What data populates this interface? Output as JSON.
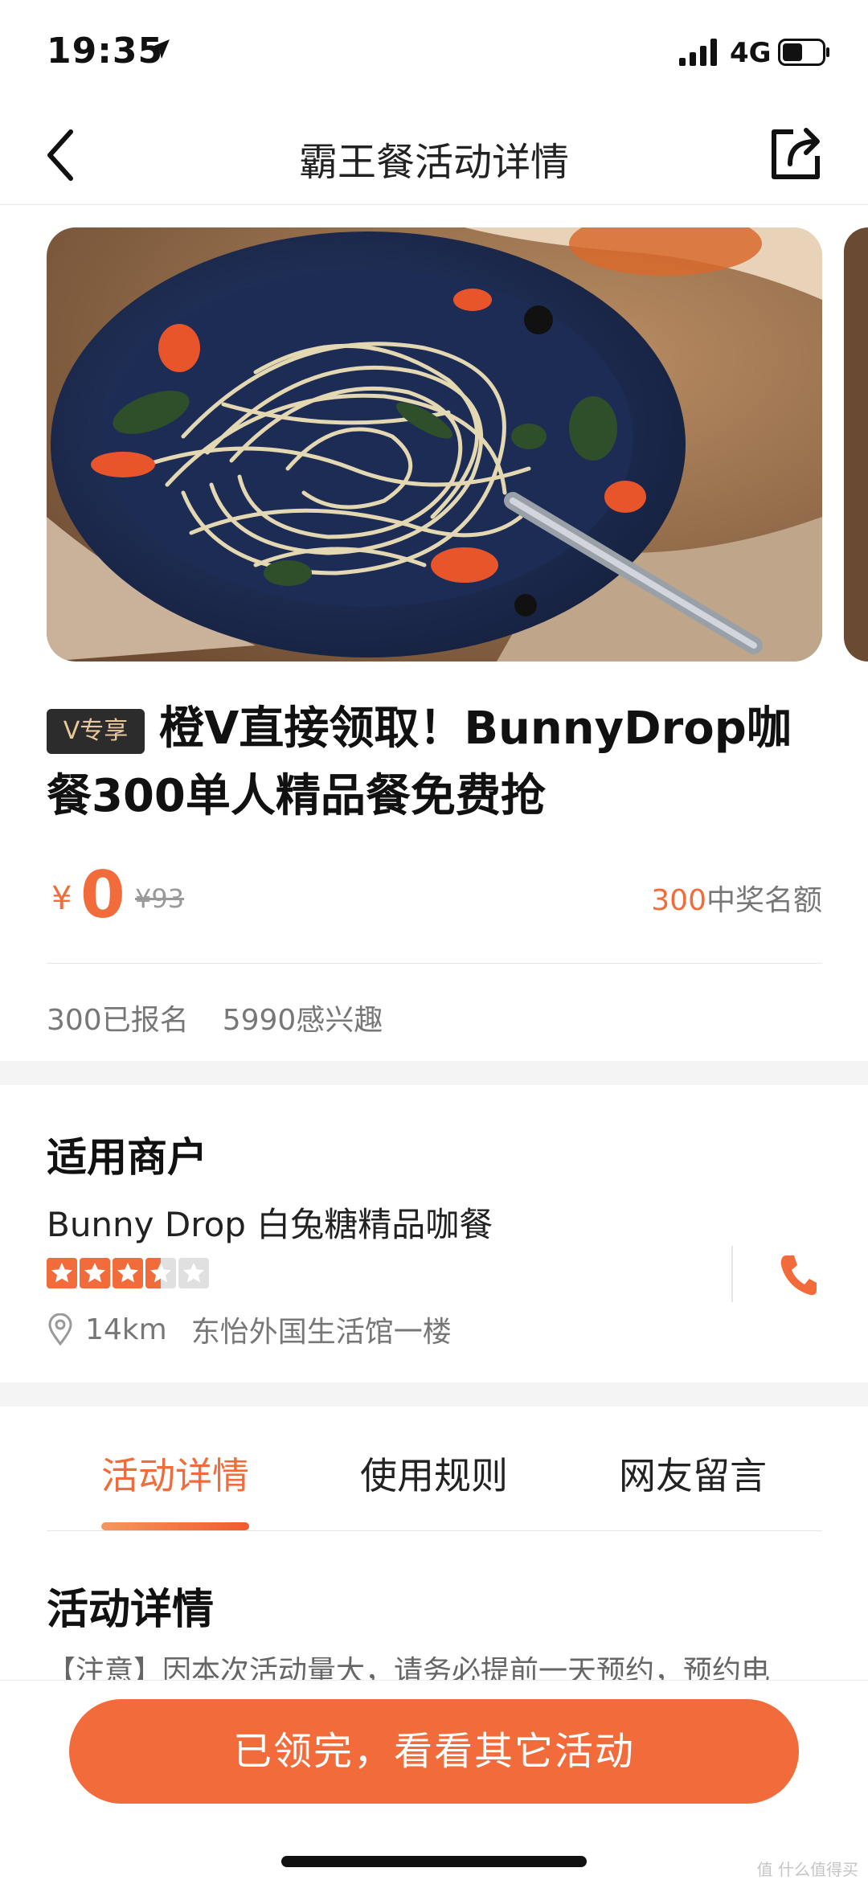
{
  "status_bar": {
    "time": "19:35",
    "network": "4G"
  },
  "nav": {
    "title": "霸王餐活动详情"
  },
  "deal": {
    "vip_tag": "V专享",
    "title": "橙V直接领取！BunnyDrop咖餐300单人精品餐免费抢",
    "currency": "¥",
    "price": "0",
    "original_price": "¥93",
    "quota_number": "300",
    "quota_label": "中奖名额",
    "signed_up": "300已报名",
    "interested": "5990感兴趣"
  },
  "merchant": {
    "section_title": "适用商户",
    "name": "Bunny Drop 白兔糖精品咖餐",
    "rating": 3.5,
    "rating_max": 5,
    "distance": "14km",
    "address": "东怡外国生活馆一楼"
  },
  "tabs": [
    {
      "label": "活动详情",
      "active": true
    },
    {
      "label": "使用规则",
      "active": false
    },
    {
      "label": "网友留言",
      "active": false
    }
  ],
  "detail": {
    "title": "活动详情",
    "text": "【注意】因本次活动量大，请务必提前一天预约，预约电"
  },
  "cta": {
    "label": "已领完，看看其它活动"
  },
  "watermark": "值 什么值得买",
  "colors": {
    "accent": "#f26b3a",
    "vip_bg": "#2c2c2c",
    "vip_text": "#e9c89a"
  }
}
